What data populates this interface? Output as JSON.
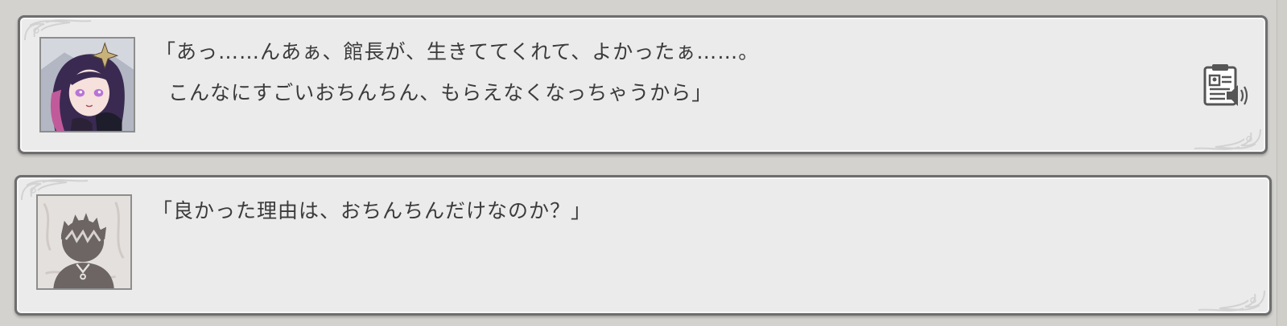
{
  "log": {
    "entries": [
      {
        "speaker_icon": "heroine-portrait",
        "lines": [
          "「あっ……んあぁ、館長が、生きててくれて、よかったぁ……。",
          "こんなにすごいおちんちん、もらえなくなっちゃうから」"
        ],
        "voice_icon": "voice-replay-icon"
      },
      {
        "speaker_icon": "player-silhouette-portrait",
        "lines": [
          "「良かった理由は、おちんちんだけなのか？」"
        ]
      }
    ]
  },
  "colors": {
    "panel_bg": "#ebebeb",
    "panel_border": "#6e6e6e",
    "text": "#3b3b3b",
    "page_bg": "#d3d2ce"
  }
}
